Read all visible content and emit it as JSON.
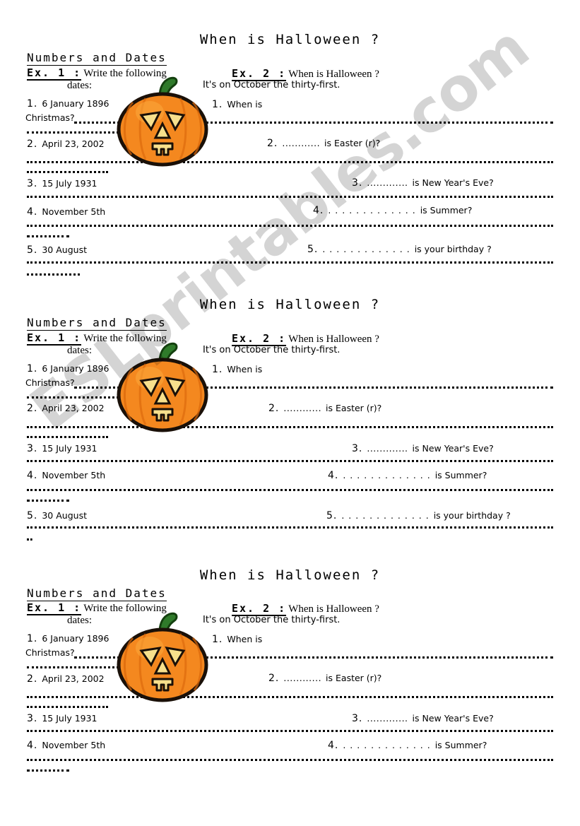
{
  "document": {
    "title": "When is Halloween ?",
    "watermark": "ESLprintables.com",
    "section_header": "Numbers and Dates",
    "exercise1": {
      "label": "Ex. 1  :",
      "instruction": "Write the following",
      "instruction_cont": "dates:",
      "items": [
        {
          "num": "1.",
          "text": "6 January 1896"
        },
        {
          "num": "2.",
          "text": "April 23, 2002"
        },
        {
          "num": "3.",
          "text": "15 July 1931"
        },
        {
          "num": "4.",
          "text": "November  5th"
        },
        {
          "num": "5.",
          "text": "30 August"
        }
      ],
      "answer_fragment": "Christmas?"
    },
    "exercise2": {
      "label": "Ex. 2  :",
      "prompt": "When is Halloween ?",
      "answer": "It's on October the thirty-first.",
      "items": [
        {
          "num": "1.",
          "text": "When is"
        },
        {
          "num": "2.",
          "dots": "............",
          "text": "is Easter (r)?"
        },
        {
          "num": "3.",
          "dots": ".............",
          "text": "is New Year's Eve?"
        },
        {
          "num": "4.",
          "dots": ". . . . . . . . . . . . .",
          "text": "is Summer?"
        },
        {
          "num": "5.",
          "dots": ". . . . . . . . . . . . .",
          "text": "is your birthday ?"
        }
      ]
    },
    "clipart": {
      "name": "jack-o-lantern-pumpkin",
      "body_color": "#F4881F",
      "body_light": "#FBA93C",
      "body_dark": "#D9660A",
      "face_color": "#F7E08C",
      "stem_color": "#2F7A2A",
      "outline_color": "#1A1008"
    }
  }
}
